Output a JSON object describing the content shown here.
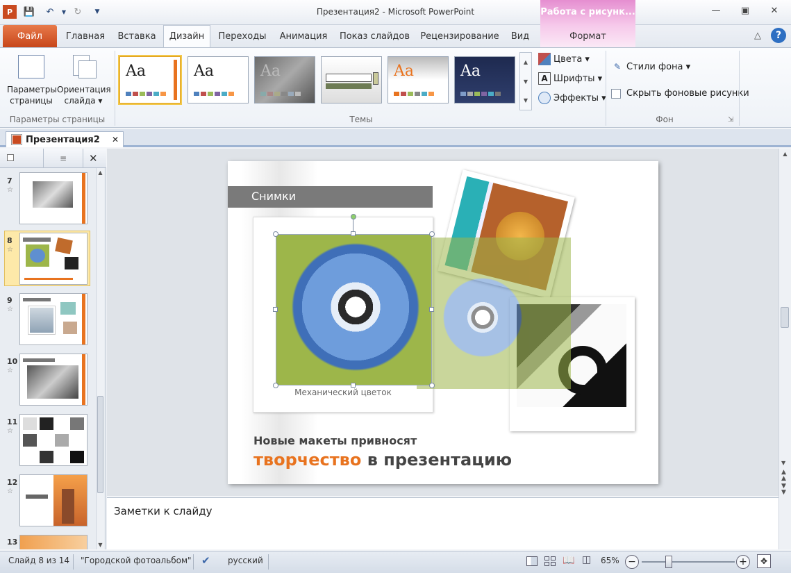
{
  "window": {
    "title": "Презентация2 - Microsoft PowerPoint",
    "context_header": "Работа с рисунк..."
  },
  "tabs": [
    {
      "label": "Файл"
    },
    {
      "label": "Главная"
    },
    {
      "label": "Вставка"
    },
    {
      "label": "Дизайн"
    },
    {
      "label": "Переходы"
    },
    {
      "label": "Анимация"
    },
    {
      "label": "Показ слайдов"
    },
    {
      "label": "Рецензирование"
    },
    {
      "label": "Вид"
    },
    {
      "label": "Формат"
    }
  ],
  "ribbon": {
    "page_setup": {
      "btn1_line1": "Параметры",
      "btn1_line2": "страницы",
      "btn2_line1": "Ориентация",
      "btn2_line2": "слайда ▾",
      "group_label": "Параметры страницы"
    },
    "themes": {
      "group_label": "Темы",
      "sample": "Aa"
    },
    "theme_options": {
      "colors": "Цвета ▾",
      "fonts": "Шрифты ▾",
      "effects": "Эффекты ▾"
    },
    "background": {
      "styles": "Стили фона ▾",
      "hide": "Скрыть фоновые рисунки",
      "group_label": "Фон"
    }
  },
  "document_tab": {
    "label": "Презентация2"
  },
  "slides_panel": {
    "items": [
      {
        "num": "7"
      },
      {
        "num": "8"
      },
      {
        "num": "9"
      },
      {
        "num": "10"
      },
      {
        "num": "11"
      },
      {
        "num": "12"
      },
      {
        "num": "13"
      }
    ]
  },
  "slide": {
    "header": "Снимки",
    "caption": "Механический цветок",
    "subtitle": "Новые макеты привносят",
    "title_orange": "творчество",
    "title_rest": " в презентацию"
  },
  "notes": {
    "placeholder": "Заметки к слайду"
  },
  "status": {
    "slide_info": "Слайд 8 из 14",
    "theme": "\"Городской фотоальбом\"",
    "language": "русский",
    "zoom": "65%"
  },
  "colors": {
    "accent_orange": "#e8731f",
    "file_tab": "#d04f1f",
    "context_pink": "#e58ed0"
  }
}
